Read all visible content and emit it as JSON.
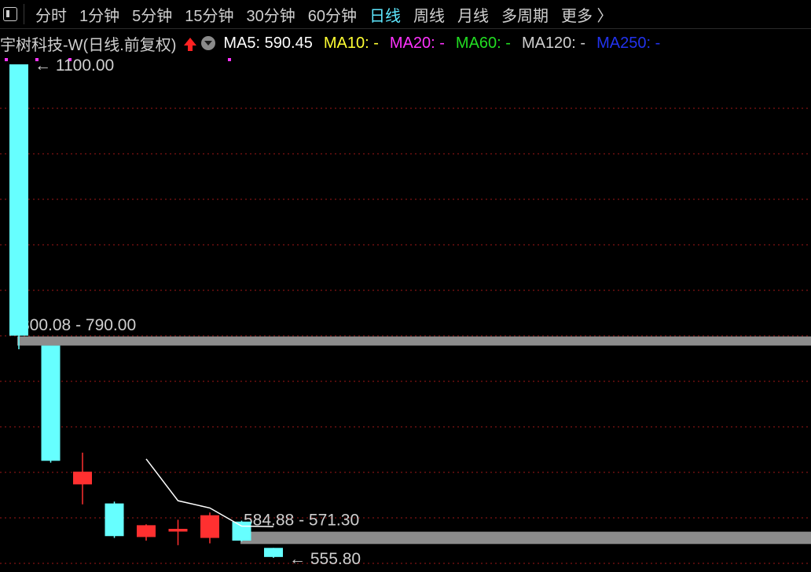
{
  "toolbar": {
    "items": [
      "分时",
      "1分钟",
      "5分钟",
      "15分钟",
      "30分钟",
      "60分钟",
      "日线",
      "周线",
      "月线",
      "多周期",
      "更多 〉"
    ],
    "active": "日线"
  },
  "stock": {
    "title": "宇树科技-W(日线.前复权)"
  },
  "ma": [
    {
      "label": "MA5: 590.45",
      "color": "#ffffff"
    },
    {
      "label": "MA10: -",
      "color": "#ffff33"
    },
    {
      "label": "MA20: -",
      "color": "#ff33ff"
    },
    {
      "label": "MA60: -",
      "color": "#22dd22"
    },
    {
      "label": "MA120: -",
      "color": "#cfcfcf"
    },
    {
      "label": "MA250: -",
      "color": "#2233ee"
    }
  ],
  "colors": {
    "up": "#ff3030",
    "down": "#66ffff",
    "grid": "#a01818",
    "band": "#8c8c8c",
    "ma5": "#ffffff"
  },
  "chart_data": {
    "type": "candlestick",
    "candles": [
      {
        "open": 1100.0,
        "high": 1100.0,
        "low": 786.0,
        "close": 801.0
      },
      {
        "open": 790.0,
        "high": 790.0,
        "low": 661.0,
        "close": 663.0
      },
      {
        "open": 637.0,
        "high": 672.0,
        "low": 615.0,
        "close": 651.0
      },
      {
        "open": 616.0,
        "high": 618.0,
        "low": 578.0,
        "close": 580.0
      },
      {
        "open": 579.0,
        "high": 593.0,
        "low": 575.0,
        "close": 592.0
      },
      {
        "open": 585.0,
        "high": 598.0,
        "low": 570.0,
        "close": 588.0
      },
      {
        "open": 578.0,
        "high": 606.0,
        "low": 572.0,
        "close": 603.0
      },
      {
        "open": 596.0,
        "high": 597.0,
        "low": 574.0,
        "close": 575.0
      },
      {
        "open": 567.0,
        "high": 567.0,
        "low": 556.0,
        "close": 557.0
      }
    ],
    "ma5": [
      null,
      null,
      null,
      null,
      665.0,
      619.0,
      611.0,
      591.0,
      590.45
    ],
    "bands": [
      {
        "label": "800.08 - 790.00",
        "high": 800.08,
        "low": 790.0
      },
      {
        "label": "584.88 - 571.30",
        "high": 584.88,
        "low": 571.3
      }
    ],
    "annotations": [
      {
        "label": "1100.00",
        "value": 1100.0,
        "candle": 0
      },
      {
        "label": "555.80",
        "value": 555.8,
        "candle": 8
      }
    ]
  }
}
